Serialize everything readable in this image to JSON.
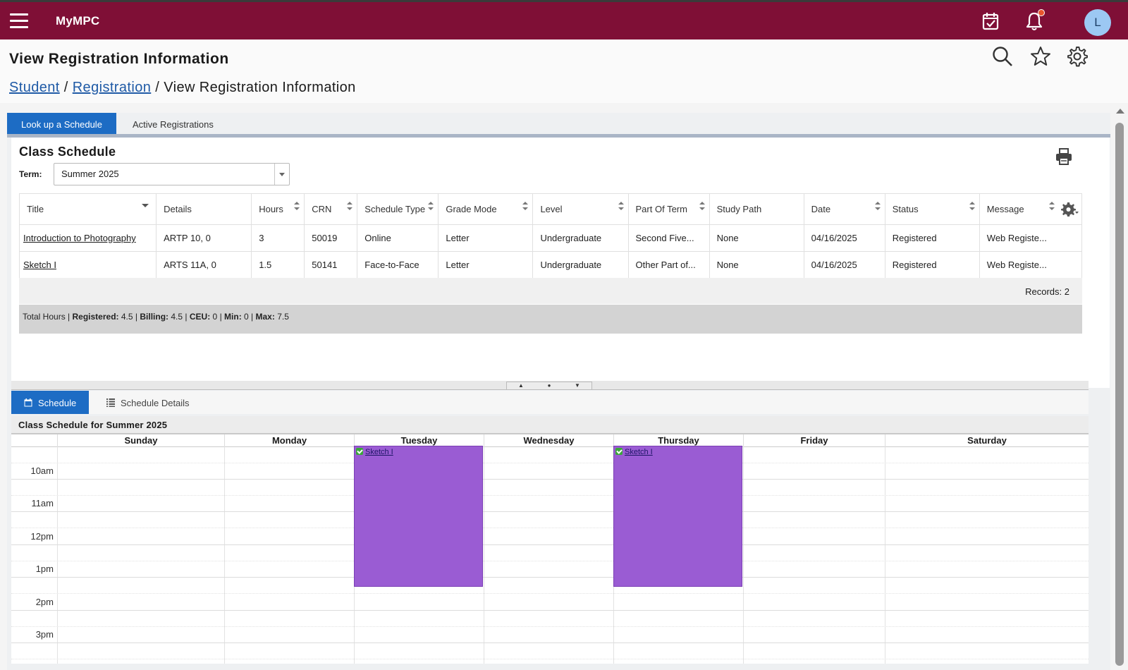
{
  "app": {
    "brand": "MyMPC",
    "avatar_initial": "L",
    "accent_color": "#7f0f36",
    "icons": [
      "menu-icon",
      "calendar-check-icon",
      "bell-icon",
      "search-icon",
      "star-icon",
      "gear-icon",
      "print-icon"
    ]
  },
  "page": {
    "title": "View Registration Information",
    "breadcrumb": {
      "student": "Student",
      "registration": "Registration",
      "current": "View Registration Information",
      "separator": "/"
    }
  },
  "tabs": {
    "lookup": "Look up a Schedule",
    "active": "Active Registrations"
  },
  "class_schedule": {
    "title": "Class Schedule",
    "term_label": "Term:",
    "term_value": "Summer 2025",
    "columns": [
      "Title",
      "Details",
      "Hours",
      "CRN",
      "Schedule Type",
      "Grade Mode",
      "Level",
      "Part Of Term",
      "Study Path",
      "Date",
      "Status",
      "Message"
    ],
    "rows": [
      [
        "Introduction to Photography",
        "ARTP 10, 0",
        "3",
        "50019",
        "Online",
        "Letter",
        "Undergraduate",
        "Second Five...",
        "None",
        "04/16/2025",
        "Registered",
        "Web Registe..."
      ],
      [
        "Sketch I",
        "ARTS 11A, 0",
        "1.5",
        "50141",
        "Face-to-Face",
        "Letter",
        "Undergraduate",
        "Other Part of...",
        "None",
        "04/16/2025",
        "Registered",
        "Web Registe..."
      ]
    ],
    "records": "Records: 2",
    "totals": {
      "prefix": "Total Hours |",
      "registered_label": "Registered:",
      "registered": "4.5",
      "billing_label": "Billing:",
      "billing": "4.5",
      "ceu_label": "CEU:",
      "ceu": "0",
      "min_label": "Min:",
      "min": "0",
      "max_label": "Max:",
      "max": "7.5"
    }
  },
  "subtabs": {
    "schedule": "Schedule",
    "details": "Schedule Details"
  },
  "calendar": {
    "title": "Class Schedule for Summer 2025",
    "days": [
      "Sunday",
      "Monday",
      "Tuesday",
      "Wednesday",
      "Thursday",
      "Friday",
      "Saturday"
    ],
    "times": [
      "10am",
      "11am",
      "12pm",
      "1pm",
      "2pm",
      "3pm"
    ],
    "events": [
      {
        "day": "Tuesday",
        "label": "Sketch I",
        "color": "#9a5cd3"
      },
      {
        "day": "Thursday",
        "label": "Sketch I",
        "color": "#9a5cd3"
      }
    ]
  }
}
